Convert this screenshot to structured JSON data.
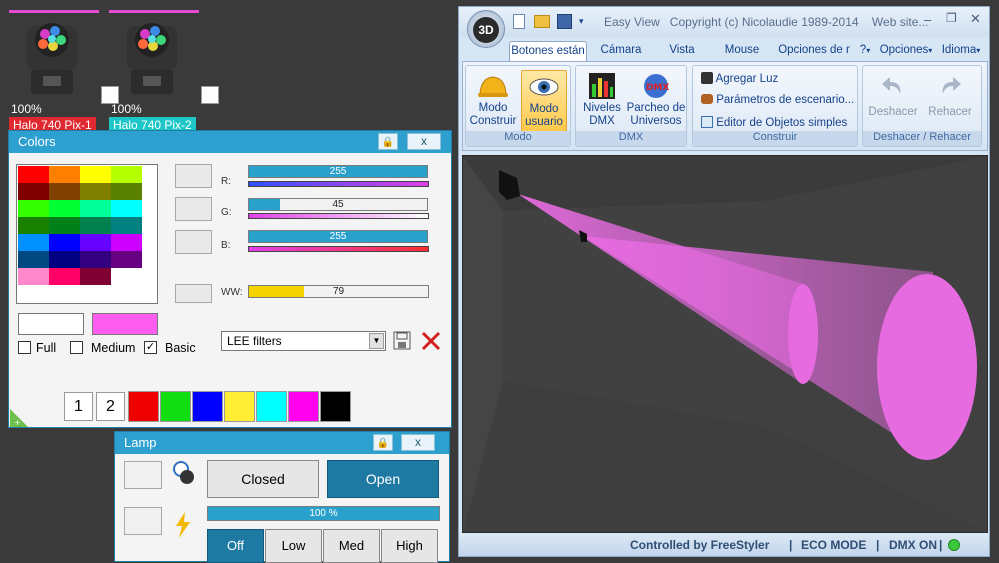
{
  "fixtures": [
    {
      "percent": "100%",
      "name": "Halo 740 Pix-1",
      "name_color": "#e02830"
    },
    {
      "percent": "100%",
      "name": "Halo 740 Pix-2",
      "name_color": "#1ec7c7"
    }
  ],
  "colors_panel": {
    "title": "Colors",
    "lock_icon": "🔒",
    "close_label": "x",
    "palette_grid": [
      [
        "#ff0000",
        "#ff8000",
        "#ffff00",
        "#b4ff00"
      ],
      [
        "#800000",
        "#804000",
        "#808000",
        "#5a8000"
      ],
      [
        "#33ff00",
        "#00ff33",
        "#00ff99",
        "#00ffff"
      ],
      [
        "#1a8000",
        "#008019",
        "#00804d",
        "#008080"
      ],
      [
        "#0090ff",
        "#0000ff",
        "#6600ff",
        "#cc00ff"
      ],
      [
        "#004880",
        "#000080",
        "#330080",
        "#660080"
      ],
      [
        "#ff88cc",
        "#ff0066",
        "#800033",
        "#ffffff"
      ]
    ],
    "channels": {
      "r_label": "R:",
      "r_value": 255,
      "r_max": 255,
      "g_label": "G:",
      "g_value": 45,
      "g_max": 255,
      "b_label": "B:",
      "b_value": 255,
      "b_max": 255,
      "ww_label": "WW:",
      "ww_value": 79,
      "ww_max": 255
    },
    "checkboxes": [
      {
        "label": "Full",
        "checked": false
      },
      {
        "label": "Medium",
        "checked": false
      },
      {
        "label": "Basic",
        "checked": true
      }
    ],
    "filter_select": "LEE filters",
    "preview_color": "#ff5cf0",
    "quick_buttons": [
      "1",
      "2"
    ],
    "quick_colors": [
      "#ee0000",
      "#11dd11",
      "#0000ff",
      "#ffee33",
      "#00ffff",
      "#ff00ee",
      "#000000"
    ],
    "colors": {
      "bar_blue": "#2aa1cc",
      "ww_yellow": "#f5d300",
      "magenta": "#e64bd3"
    }
  },
  "lamp_panel": {
    "title": "Lamp",
    "close_label": "x",
    "closed_label": "Closed",
    "open_label": "Open",
    "intensity": "100 %",
    "intensity_fraction": 1.0,
    "modes": [
      "Off",
      "Low",
      "Med",
      "High"
    ],
    "active_mode": "Off"
  },
  "app": {
    "logo": "3D",
    "title_text": "Easy View   Copyright (c) Nicolaudie 1989-2014    Web site...",
    "tabs": [
      "Botones están",
      "Cámara",
      "Vista",
      "Mouse",
      "Opciones de r",
      "?",
      "Opciones",
      "Idioma"
    ],
    "active_tab": "Botones están",
    "groups": {
      "modo": {
        "label": "Modo",
        "buttons": [
          {
            "line1": "Modo",
            "line2": "Construir",
            "icon": "hardhat-icon"
          },
          {
            "line1": "Modo",
            "line2": "usuario",
            "icon": "eye-icon"
          }
        ]
      },
      "dmx": {
        "label": "DMX",
        "buttons": [
          {
            "line1": "Niveles",
            "line2": "DMX",
            "icon": "equalizer-icon"
          },
          {
            "line1": "Parcheo de",
            "line2": "Universos",
            "icon": "dmx-globe-icon"
          }
        ]
      },
      "construir": {
        "label": "Construir",
        "items": [
          "Agregar Luz",
          "Parámetros de escenario...",
          "Editor de Objetos simples"
        ]
      },
      "undo": {
        "label": "Deshacer / Rehacer",
        "undo": "Deshacer",
        "redo": "Rehacer"
      }
    },
    "status": {
      "controlled": "Controlled by FreeStyler",
      "eco": "ECO MODE",
      "dmx": "DMX ON",
      "dmx_color": "#3cc83c"
    }
  }
}
